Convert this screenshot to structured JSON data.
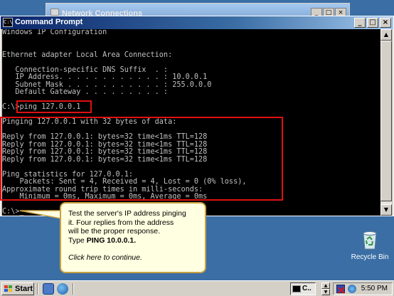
{
  "background_window": {
    "title": "Network Connections",
    "min_glyph": "_",
    "max_glyph": "□",
    "close_glyph": "×"
  },
  "cmd_window": {
    "title": "Command Prompt",
    "icon_text": "C:\\",
    "min_glyph": "_",
    "max_glyph": "□",
    "close_glyph": "×"
  },
  "console": {
    "lines": [
      "Windows IP Configuration",
      "",
      "",
      "Ethernet adapter Local Area Connection:",
      "",
      "   Connection-specific DNS Suffix  . :",
      "   IP Address. . . . . . . . . . . . : 10.0.0.1",
      "   Subnet Mask . . . . . . . . . . . : 255.0.0.0",
      "   Default Gateway . . . . . . . . . :",
      "",
      "C:\\>ping 127.0.0.1",
      "",
      "Pinging 127.0.0.1 with 32 bytes of data:",
      "",
      "Reply from 127.0.0.1: bytes=32 time<1ms TTL=128",
      "Reply from 127.0.0.1: bytes=32 time<1ms TTL=128",
      "Reply from 127.0.0.1: bytes=32 time<1ms TTL=128",
      "Reply from 127.0.0.1: bytes=32 time<1ms TTL=128",
      "",
      "Ping statistics for 127.0.0.1:",
      "    Packets: Sent = 4, Received = 4, Lost = 0 (0% loss),",
      "Approximate round trip times in milli-seconds:",
      "    Minimum = 0ms, Maximum = 0ms, Average = 0ms",
      "",
      "C:\\>_"
    ]
  },
  "balloon": {
    "line1": "Test the server's IP address pinging",
    "line2": "it.  Four replies from the address",
    "line3": "will be the proper response.",
    "type_prefix": "Type ",
    "command": "PING 10.0.0.1.",
    "continue_text": "Click here to continue."
  },
  "desktop": {
    "recycle_label": "Recycle Bin"
  },
  "taskbar": {
    "start_label": "Start",
    "task_label": "C..",
    "clock": "5:50 PM",
    "spin_up": "▲",
    "spin_down": "▼"
  },
  "colors": {
    "highlight": "#e01010",
    "balloon_bg": "#ffffe1",
    "desktop_bg": "#3a6ea5",
    "console_text": "#c0c0c0"
  }
}
